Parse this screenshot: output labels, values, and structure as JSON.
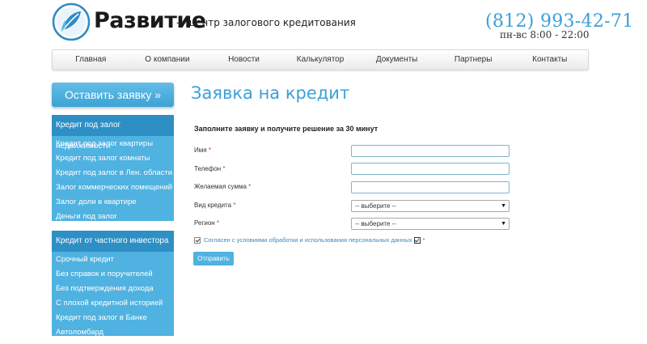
{
  "header": {
    "brand": "Развитие",
    "tagline": "— центр залогового кредитования",
    "phone": "(812) 993-42-71",
    "hours": "пн-вс 8:00 - 22:00"
  },
  "nav": [
    "Главная",
    "О компании",
    "Новости",
    "Калькулятор",
    "Документы",
    "Партнеры",
    "Контакты"
  ],
  "sidebar": {
    "cta": "Оставить заявку »",
    "group1": {
      "title": "Кредит под залог недвижимости",
      "items": [
        "Кредит под залог квартиры",
        "Кредит под залог комнаты",
        "Кредит под залог в Лен. области",
        "Залог коммерческих помещений",
        "Залог доли в квартире",
        "Деньги под залог"
      ]
    },
    "group2": {
      "title": "Кредит от частного инвестора",
      "items": [
        "Срочный кредит",
        "Без справок и поручителей",
        "Без подтверждения дохода",
        "С плохой кредитной историей",
        "Кредит под залог в Банке",
        "Автоломбард"
      ]
    }
  },
  "main": {
    "title": "Заявка на кредит",
    "form_heading": "Заполните заявку и получите решение за 30 минут",
    "fields": {
      "name": "Имя",
      "phone": "Телефон",
      "amount": "Желаемая сумма",
      "credit_type": "Вид кредита",
      "region": "Регион"
    },
    "required_mark": "*",
    "select_placeholder": "-- выберите --",
    "agree_text": "Согласен с условиями обработки и использования персональных данных",
    "submit": "Отправить"
  },
  "colors": {
    "accent": "#3ba0d9",
    "sidebar_bg": "#4fb2e0",
    "sidebar_title": "#2e8fc5"
  }
}
